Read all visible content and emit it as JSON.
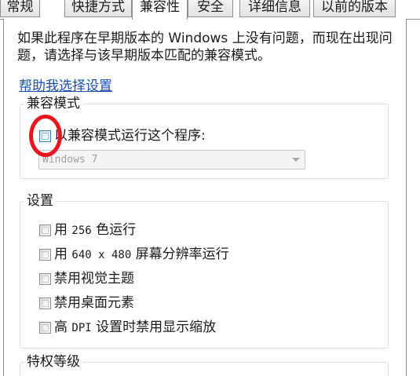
{
  "tabs": [
    {
      "label": "常规",
      "active": false
    },
    {
      "label": "快捷方式",
      "active": false
    },
    {
      "label": "兼容性",
      "active": true
    },
    {
      "label": "安全",
      "active": false
    },
    {
      "label": "详细信息",
      "active": false
    },
    {
      "label": "以前的版本",
      "active": false
    }
  ],
  "intro_text": "如果此程序在早期版本的 Windows 上没有问题，而现在出现问题，请选择与该早期版本匹配的兼容模式。",
  "help_link": "帮助我选择设置",
  "compat_mode": {
    "title": "兼容模式",
    "run_in_compat_label": "以兼容模式运行这个程序:",
    "run_in_compat_checked": false,
    "os_selected": "Windows 7"
  },
  "settings": {
    "title": "设置",
    "options": [
      {
        "prefix": "用",
        "mono": "256",
        "suffix": "色运行",
        "checked": false
      },
      {
        "prefix": "用",
        "mono": "640 x 480",
        "suffix": "屏幕分辨率运行",
        "checked": false
      },
      {
        "prefix": "禁用视觉主题",
        "mono": "",
        "suffix": "",
        "checked": false
      },
      {
        "prefix": "禁用桌面元素",
        "mono": "",
        "suffix": "",
        "checked": false
      },
      {
        "prefix": "高",
        "mono": "DPI",
        "suffix": "设置时禁用显示缩放",
        "checked": false
      }
    ]
  },
  "privilege": {
    "title": "特权等级"
  },
  "colors": {
    "link": "#1b4fb0",
    "annotation_red": "#e8151f",
    "group_border": "#d5dfe5"
  }
}
